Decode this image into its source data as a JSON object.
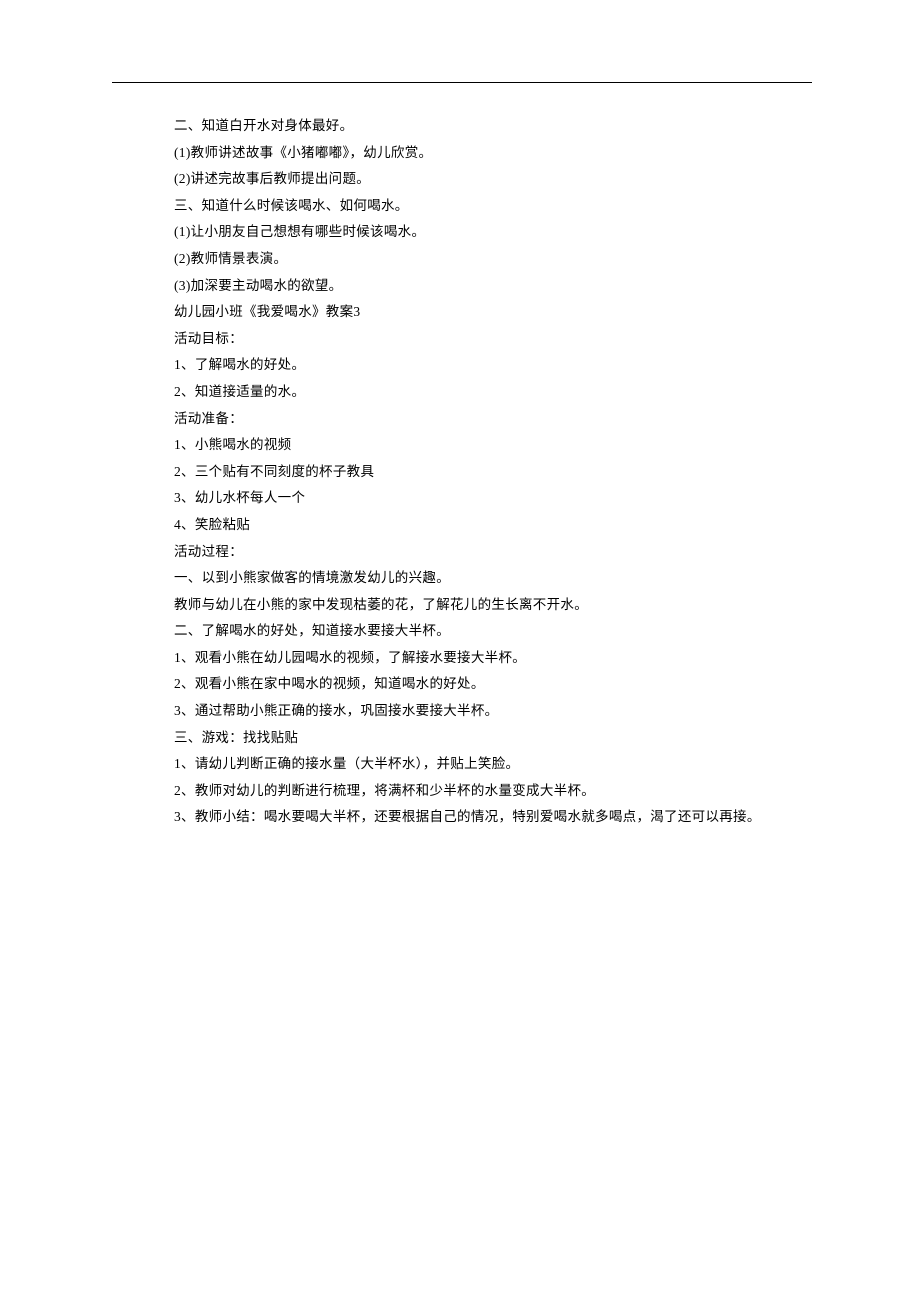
{
  "lines": [
    "二、知道白开水对身体最好。",
    "(1)教师讲述故事《小猪嘟嘟》，幼儿欣赏。",
    "(2)讲述完故事后教师提出问题。",
    "三、知道什么时候该喝水、如何喝水。",
    "(1)让小朋友自己想想有哪些时候该喝水。",
    "(2)教师情景表演。",
    "(3)加深要主动喝水的欲望。",
    "幼儿园小班《我爱喝水》教案3",
    "活动目标：",
    "1、了解喝水的好处。",
    "2、知道接适量的水。",
    "活动准备：",
    "1、小熊喝水的视频",
    "2、三个贴有不同刻度的杯子教具",
    "3、幼儿水杯每人一个",
    "4、笑脸粘贴",
    "活动过程：",
    "一、以到小熊家做客的情境激发幼儿的兴趣。",
    "教师与幼儿在小熊的家中发现枯萎的花，了解花儿的生长离不开水。",
    "二、了解喝水的好处，知道接水要接大半杯。",
    "1、观看小熊在幼儿园喝水的视频，了解接水要接大半杯。",
    "2、观看小熊在家中喝水的视频，知道喝水的好处。",
    "3、通过帮助小熊正确的接水，巩固接水要接大半杯。",
    "三、游戏：找找贴贴",
    "1、请幼儿判断正确的接水量（大半杯水），并贴上笑脸。",
    "2、教师对幼儿的判断进行梳理，将满杯和少半杯的水量变成大半杯。",
    "3、教师小结：喝水要喝大半杯，还要根据自己的情况，特别爱喝水就多喝点，渴了还可以再接。"
  ]
}
